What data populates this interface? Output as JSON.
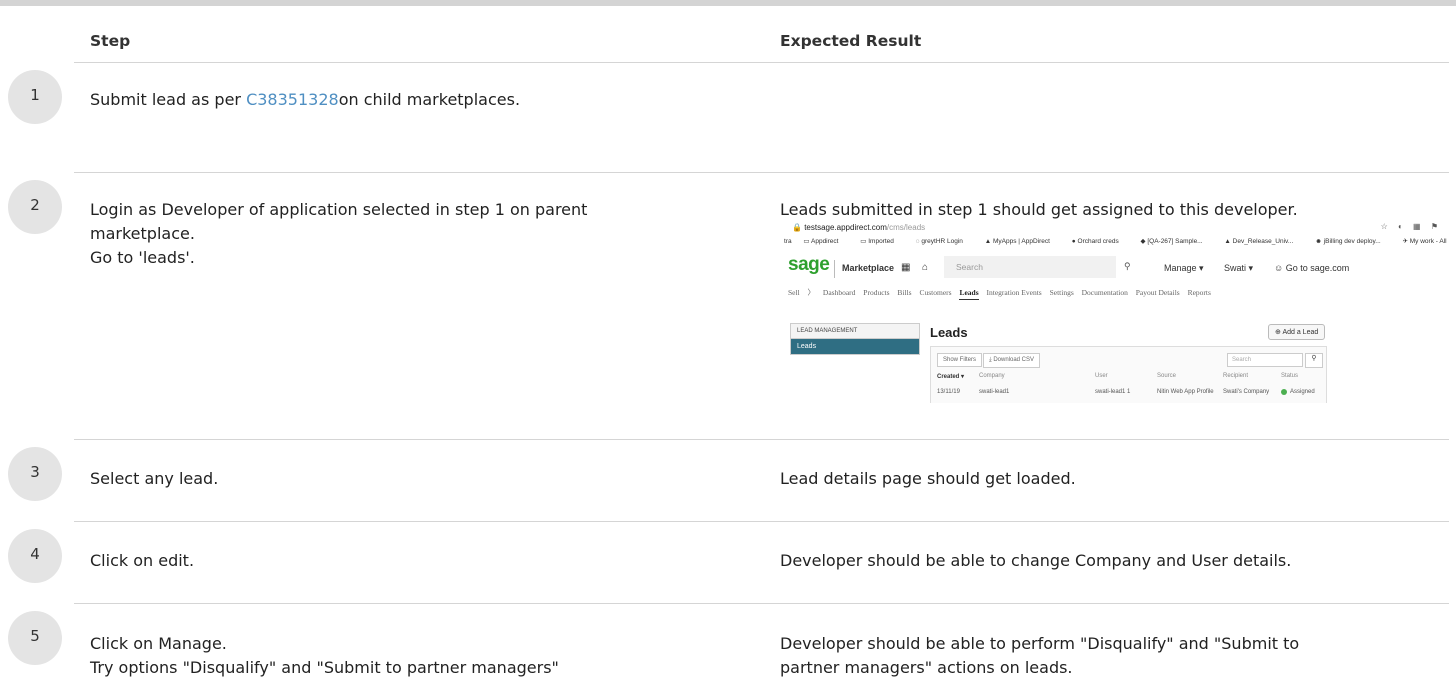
{
  "columns": {
    "step": "Step",
    "expected": "Expected Result"
  },
  "rows": [
    {
      "num": "1",
      "step_prefix": "Submit lead as per ",
      "step_link": "C38351328",
      "step_suffix": "on child marketplaces.",
      "expected": []
    },
    {
      "num": "2",
      "step": [
        "Login as Developer of application selected in step 1 on parent",
        "marketplace.",
        "Go to 'leads'."
      ],
      "expected": [
        "Leads submitted in step 1 should get assigned to this developer."
      ]
    },
    {
      "num": "3",
      "step": [
        "Select any lead."
      ],
      "expected": [
        "Lead details page should get loaded."
      ]
    },
    {
      "num": "4",
      "step": [
        "Click on edit."
      ],
      "expected": [
        "Developer should be able to change Company and User details."
      ]
    },
    {
      "num": "5",
      "step": [
        "Click on Manage.",
        "Try options \"Disqualify\" and \"Submit to partner managers\""
      ],
      "expected": [
        "Developer should be able to perform \"Disqualify\" and \"Submit to",
        "partner managers\" actions on leads."
      ]
    }
  ],
  "screenshot": {
    "url_host": "testsage.appdirect.com",
    "url_path": "/cms/leads",
    "bookmarks": [
      "tra",
      "Appdirect",
      "Imported",
      "greytHR Login",
      "MyApps | AppDirect",
      "Orchard creds",
      "[QA-267] Sample...",
      "Dev_Release_Univ...",
      "jBilling dev deploy...",
      "My work - All"
    ],
    "logo": "sage",
    "marketplace": "Marketplace",
    "search_placeholder": "Search",
    "manage": "Manage ▾",
    "user": "Swati ▾",
    "goto": "☺ Go to sage.com",
    "subnav": [
      "Sell",
      "Dashboard",
      "Products",
      "Bills",
      "Customers",
      "Leads",
      "Integration Events",
      "Settings",
      "Documentation",
      "Payout Details",
      "Reports"
    ],
    "side_heading": "LEAD MANAGEMENT",
    "side_item": "Leads",
    "page_title": "Leads",
    "add_lead": "Add a Lead",
    "show_filters": "Show Filters",
    "download_csv": "Download CSV",
    "table_search": "Search",
    "table_headers": [
      "Created ▾",
      "Company",
      "User",
      "Source",
      "Recipient",
      "Status"
    ],
    "table_row": [
      "13/11/19",
      "swati-lead1",
      "swati-lead1 1",
      "Nitin Web App Profile",
      "Swati's Company",
      "Assigned"
    ]
  }
}
